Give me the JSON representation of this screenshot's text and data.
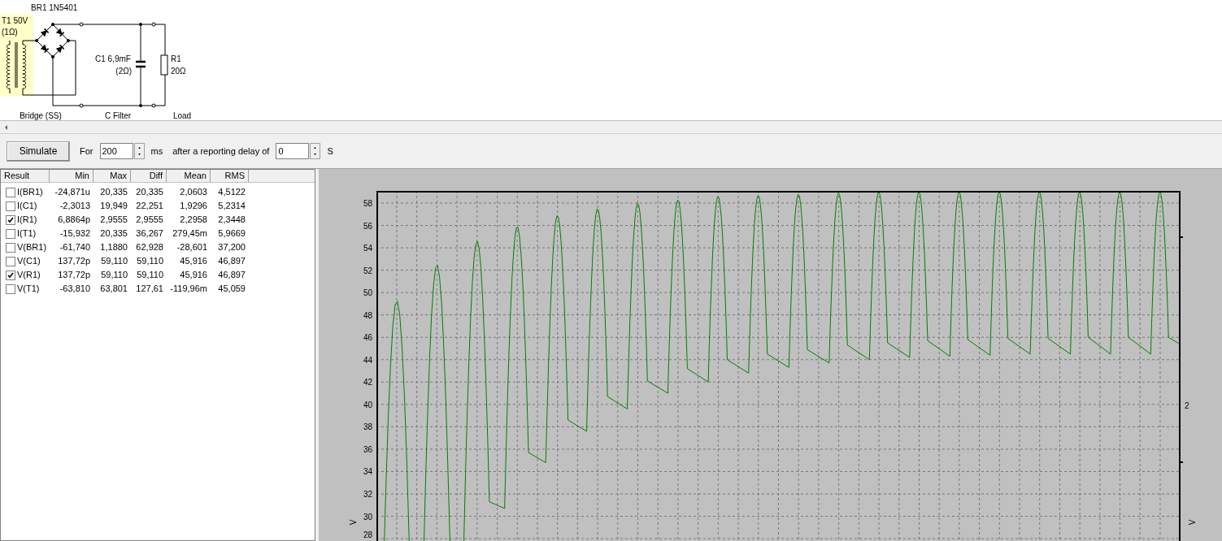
{
  "schematic": {
    "bridge": {
      "name": "BR1 1N5401"
    },
    "transformer": {
      "name": "T1 50V",
      "resistance": "(1Ω)"
    },
    "capacitor": {
      "name": "C1 6,9mF",
      "resistance": "(2Ω)"
    },
    "resistor": {
      "name": "R1",
      "value": "20Ω"
    },
    "stage_labels": [
      "Bridge (SS)",
      "C Filter",
      "Load"
    ]
  },
  "toolbar": {
    "simulate_button": "Simulate",
    "for_label": "For",
    "duration": "200",
    "duration_unit": "ms",
    "delay_label": "after a reporting delay of",
    "delay": "0",
    "delay_unit": "S"
  },
  "results": {
    "columns": [
      "Result",
      "Min",
      "Max",
      "Diff",
      "Mean",
      "RMS"
    ],
    "rows": [
      {
        "checked": false,
        "cells": [
          "I(BR1)",
          "-24,871u",
          "20,335",
          "20,335",
          "2,0603",
          "4,5122"
        ]
      },
      {
        "checked": false,
        "cells": [
          "I(C1)",
          "-2,3013",
          "19,949",
          "22,251",
          "1,9296",
          "5,2314"
        ]
      },
      {
        "checked": true,
        "cells": [
          "I(R1)",
          "6,8864p",
          "2,9555",
          "2,9555",
          "2,2958",
          "2,3448"
        ]
      },
      {
        "checked": false,
        "cells": [
          "I(T1)",
          "-15,932",
          "20,335",
          "36,267",
          "279,45m",
          "5,9669"
        ]
      },
      {
        "checked": false,
        "cells": [
          "V(BR1)",
          "-61,740",
          "1,1880",
          "62,928",
          "-28,601",
          "37,200"
        ]
      },
      {
        "checked": false,
        "cells": [
          "V(C1)",
          "137,72p",
          "59,110",
          "59,110",
          "45,916",
          "46,897"
        ]
      },
      {
        "checked": true,
        "cells": [
          "V(R1)",
          "137,72p",
          "59,110",
          "59,110",
          "45,916",
          "46,897"
        ]
      },
      {
        "checked": false,
        "cells": [
          "V(T1)",
          "-63,810",
          "63,801",
          "127,61",
          "-119,96m",
          "45,059"
        ]
      }
    ]
  },
  "plot": {
    "y_ticks": [
      "58",
      "56",
      "54",
      "52",
      "50",
      "48",
      "46",
      "44",
      "42",
      "40",
      "38",
      "36",
      "34",
      "32",
      "30",
      "28"
    ],
    "left_axis_label": "V",
    "right_axis_tick": "2",
    "right_axis_label": "V"
  }
}
